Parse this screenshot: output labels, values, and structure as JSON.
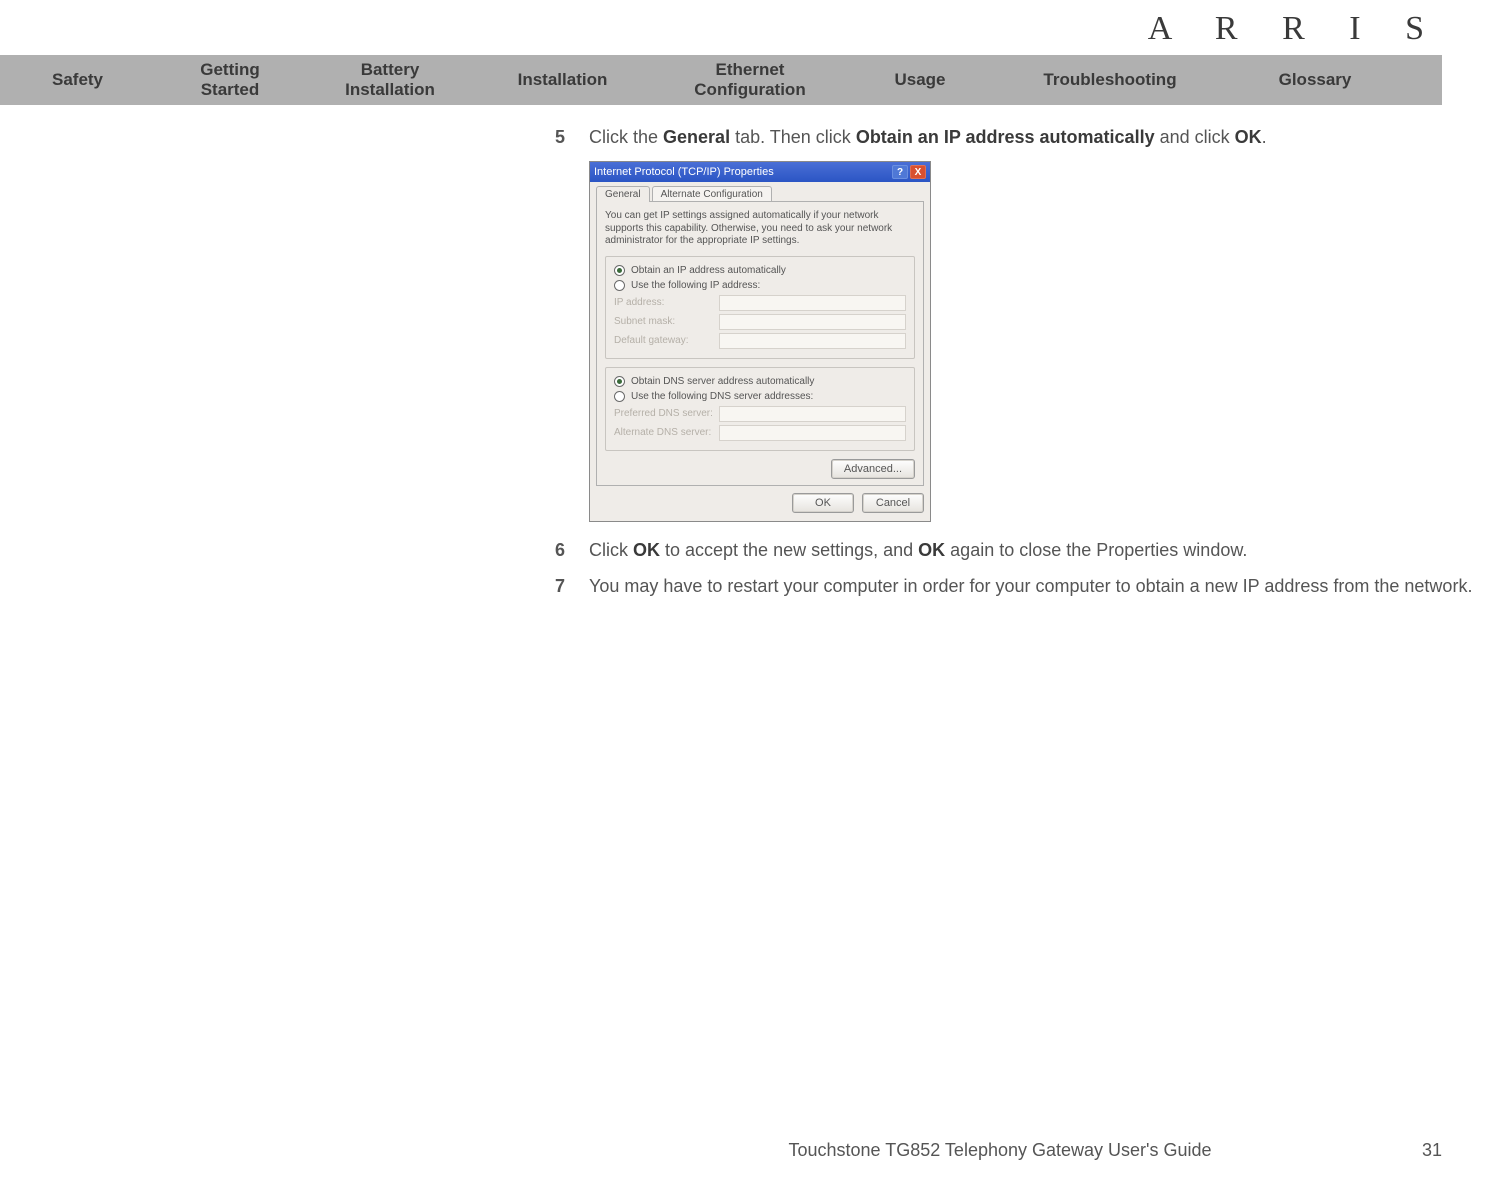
{
  "brand": "A R R I S",
  "nav": {
    "items": [
      "Safety",
      "Getting\nStarted",
      "Battery\nInstallation",
      "Installation",
      "Ethernet\nConfiguration",
      "Usage",
      "Troubleshooting",
      "Glossary"
    ]
  },
  "steps": {
    "s5": {
      "num": "5",
      "pre": "Click the ",
      "b1": "General",
      "mid1": " tab. Then click ",
      "b2": "Obtain an IP address automatically",
      "mid2": " and click ",
      "b3": "OK",
      "post": "."
    },
    "s6": {
      "num": "6",
      "pre": "Click ",
      "b1": "OK",
      "mid1": " to accept the new settings, and ",
      "b2": "OK",
      "post": " again to close the Properties window."
    },
    "s7": {
      "num": "7",
      "text": "You may have to restart your computer in order for your computer to obtain a new IP address from the network."
    }
  },
  "dialog": {
    "title": "Internet Protocol (TCP/IP) Properties",
    "help_icon": "?",
    "close_icon": "X",
    "tab_general": "General",
    "tab_alt": "Alternate Configuration",
    "desc": "You can get IP settings assigned automatically if your network supports this capability. Otherwise, you need to ask your network administrator for the appropriate IP settings.",
    "ip_auto": "Obtain an IP address automatically",
    "ip_manual": "Use the following IP address:",
    "ip_addr": "IP address:",
    "subnet": "Subnet mask:",
    "gateway": "Default gateway:",
    "dns_auto": "Obtain DNS server address automatically",
    "dns_manual": "Use the following DNS server addresses:",
    "dns_pref": "Preferred DNS server:",
    "dns_alt": "Alternate DNS server:",
    "advanced": "Advanced...",
    "ok": "OK",
    "cancel": "Cancel"
  },
  "footer": {
    "title": "Touchstone TG852 Telephony Gateway User's Guide",
    "page": "31"
  }
}
